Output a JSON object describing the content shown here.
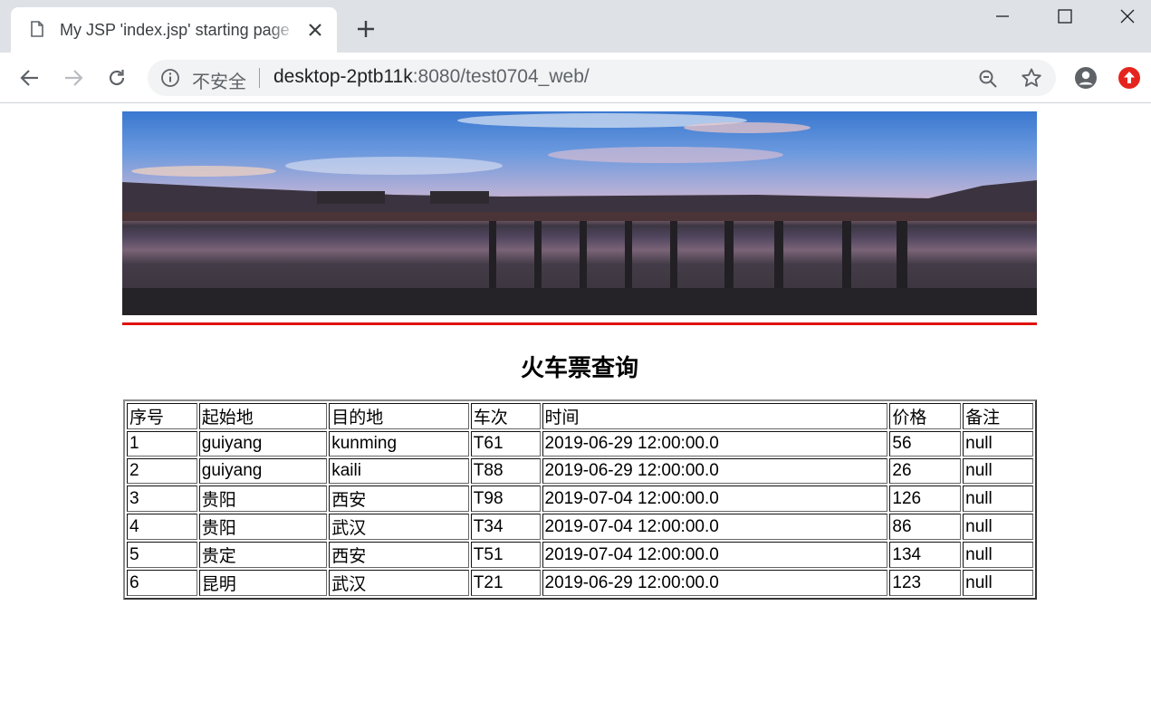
{
  "browser": {
    "tab_title": "My JSP 'index.jsp' starting page",
    "security_label": "不安全",
    "url_host": "desktop-2ptb11k",
    "url_rest": ":8080/test0704_web/"
  },
  "page": {
    "title": "火车票查询"
  },
  "table": {
    "headers": [
      "序号",
      "起始地",
      "目的地",
      "车次",
      "时间",
      "价格",
      "备注"
    ],
    "rows": [
      [
        "1",
        "guiyang",
        "kunming",
        "T61",
        "2019-06-29 12:00:00.0",
        "56",
        "null"
      ],
      [
        "2",
        "guiyang",
        "kaili",
        "T88",
        "2019-06-29 12:00:00.0",
        "26",
        "null"
      ],
      [
        "3",
        "贵阳",
        "西安",
        "T98",
        "2019-07-04 12:00:00.0",
        "126",
        "null"
      ],
      [
        "4",
        "贵阳",
        "武汉",
        "T34",
        "2019-07-04 12:00:00.0",
        "86",
        "null"
      ],
      [
        "5",
        "贵定",
        "西安",
        "T51",
        "2019-07-04 12:00:00.0",
        "134",
        "null"
      ],
      [
        "6",
        "昆明",
        "武汉",
        "T21",
        "2019-06-29 12:00:00.0",
        "123",
        "null"
      ]
    ]
  },
  "colors": {
    "divider": "#e0120f",
    "update_badge": "#e5251d"
  },
  "icons": [
    "document-icon",
    "close-icon",
    "plus-icon",
    "minimize-icon",
    "maximize-icon",
    "close-window-icon",
    "back-icon",
    "forward-icon",
    "reload-icon",
    "info-icon",
    "zoom-icon",
    "star-icon",
    "profile-icon",
    "update-icon"
  ]
}
